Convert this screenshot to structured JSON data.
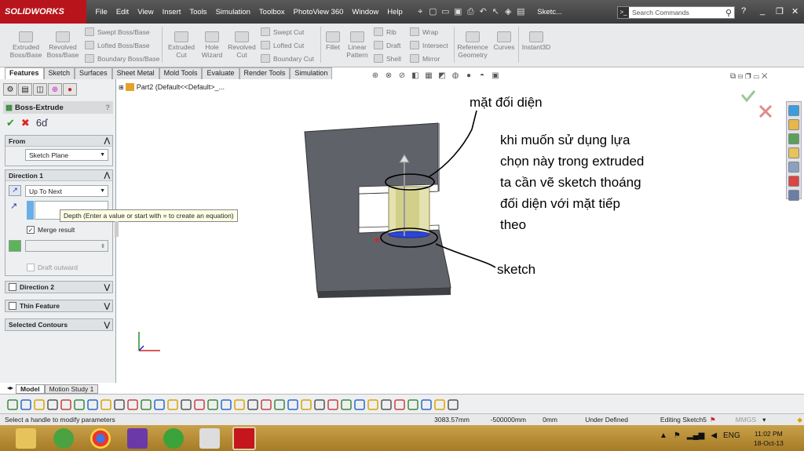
{
  "app": {
    "brand": "SOLIDWORKS",
    "menu": [
      "File",
      "Edit",
      "View",
      "Insert",
      "Tools",
      "Simulation",
      "Toolbox",
      "PhotoView 360",
      "Window",
      "Help"
    ],
    "doc_title": "Sketc...",
    "search_placeholder": "Search Commands"
  },
  "command_manager": {
    "large": [
      {
        "label": "Extruded\nBoss/Base"
      },
      {
        "label": "Revolved\nBoss/Base"
      },
      {
        "label": "Extruded\nCut"
      },
      {
        "label": "Hole\nWizard"
      },
      {
        "label": "Revolved\nCut"
      },
      {
        "label": "Fillet"
      },
      {
        "label": "Linear\nPattern"
      },
      {
        "label": "Reference\nGeometry"
      },
      {
        "label": "Curves"
      },
      {
        "label": "Instant3D"
      }
    ],
    "small": [
      "Swept Boss/Base",
      "Lofted Boss/Base",
      "Boundary Boss/Base",
      "Swept Cut",
      "Lofted Cut",
      "Boundary Cut",
      "Rib",
      "Draft",
      "Shell",
      "Wrap",
      "Intersect",
      "Mirror"
    ],
    "tabs": [
      "Features",
      "Sketch",
      "Surfaces",
      "Sheet Metal",
      "Mold Tools",
      "Evaluate",
      "Render Tools",
      "Simulation"
    ]
  },
  "property_manager": {
    "title": "Boss-Extrude",
    "help": "?",
    "from_label": "From",
    "from_value": "Sketch Plane",
    "dir1_label": "Direction 1",
    "dir1_value": "Up To Next",
    "merge_label": "Merge result",
    "draft_label": "Draft outward",
    "dir2_label": "Direction 2",
    "thin_label": "Thin Feature",
    "contours_label": "Selected Contours",
    "tooltip": "Depth (Enter a value or start with = to create an equation)"
  },
  "tree": {
    "part": "Part2  (Default<<Default>_..."
  },
  "annotations": {
    "opposite_face": "mặt đối diện",
    "note": [
      "khi muốn sử dụng lựa",
      "chọn này trong extruded",
      "ta cần vẽ sketch thoáng",
      "đối diện với mặt tiếp",
      "theo"
    ],
    "sketch": "sketch"
  },
  "bottom_tabs": [
    "Model",
    "Motion Study 1"
  ],
  "status": {
    "message": "Select a handle to modify parameters",
    "x": "3083.57mm",
    "y": "-500000mm",
    "z": "0mm",
    "state": "Under Defined",
    "editing": "Editing Sketch5",
    "units": "MMGS"
  },
  "taskbar": {
    "lang": "ENG",
    "time": "11:02 PM",
    "date": "18-Oct-13"
  },
  "colors": {
    "brand_red": "#b8141b",
    "part_gray": "#5e6068",
    "taskbar": "#b88d36",
    "sketch_blue": "#1f3cc8"
  }
}
